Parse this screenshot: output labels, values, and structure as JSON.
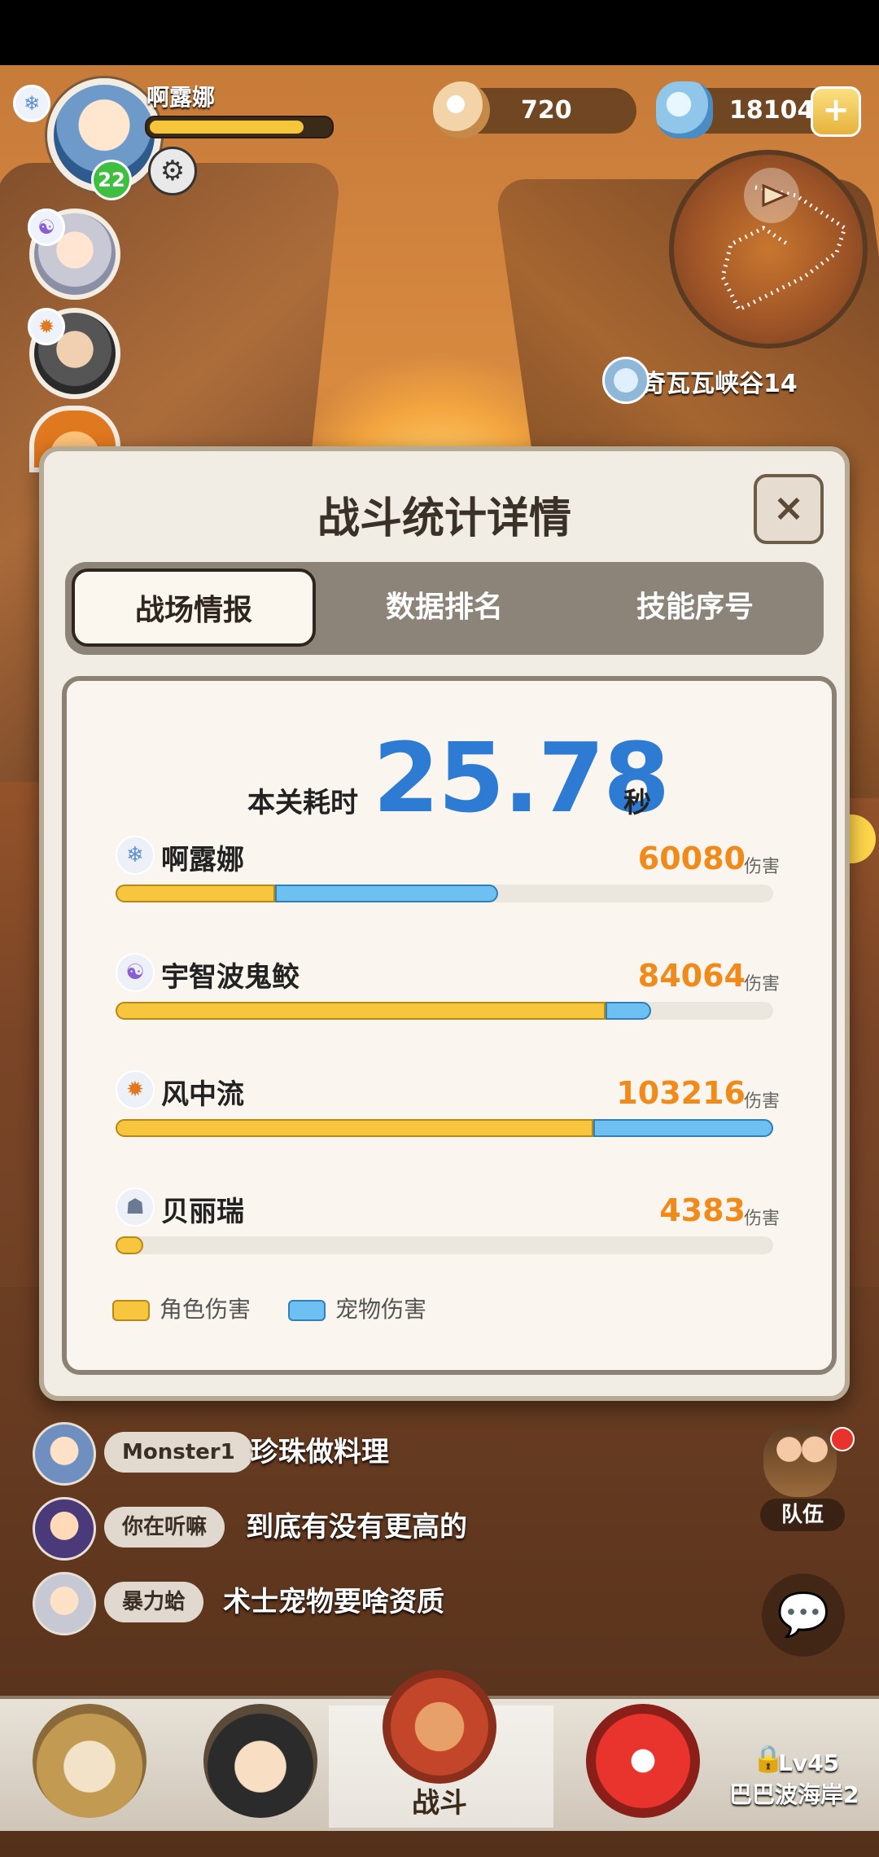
{
  "player": {
    "name": "啊露娜",
    "level": "22",
    "hp_fraction": 0.86
  },
  "currency": {
    "pearls": "720",
    "shells": "18104",
    "add_label": "+"
  },
  "location": "奇瓦瓦峡谷14",
  "side_chat_label": "聊天",
  "chat": [
    {
      "tag": "Monster1",
      "msg": "珍珠做料理"
    },
    {
      "tag": "你在听嘛",
      "msg": "到底有没有更高的"
    },
    {
      "tag": "暴力蛤",
      "msg": "术士宠物要啥资质"
    }
  ],
  "team_label": "队伍",
  "bottom_nav": {
    "battle_label": "战斗",
    "locked_level": "Lv45",
    "locked_name": "巴巴波海岸2"
  },
  "modal": {
    "title": "战斗统计详情",
    "close_label": "×",
    "tabs": [
      "战场情报",
      "数据排名",
      "技能序号"
    ],
    "active_tab": 0,
    "time_label": "本关耗时",
    "time_value": "25.78",
    "time_unit": "秒",
    "damage_unit": "伤害",
    "colors": {
      "role": "#f7c63e",
      "pet": "#6ec0f2",
      "value": "#f08a1a",
      "time": "#2d7bd2"
    },
    "rows": [
      {
        "name": "啊露娜",
        "value": "60080",
        "icon": "ice-element-icon",
        "role_frac": 0.242,
        "pet_frac": 0.339
      },
      {
        "name": "宇智波鬼鲛",
        "value": "84064",
        "icon": "shadow-element-icon",
        "role_frac": 0.745,
        "pet_frac": 0.069
      },
      {
        "name": "风中流",
        "value": "103216",
        "icon": "fire-element-icon",
        "role_frac": 0.727,
        "pet_frac": 0.273
      },
      {
        "name": "贝丽瑞",
        "value": "4383",
        "icon": "ghost-element-icon",
        "role_frac": 0.042,
        "pet_frac": 0.0
      }
    ],
    "legend": {
      "role": "角色伤害",
      "pet": "宠物伤害"
    }
  }
}
